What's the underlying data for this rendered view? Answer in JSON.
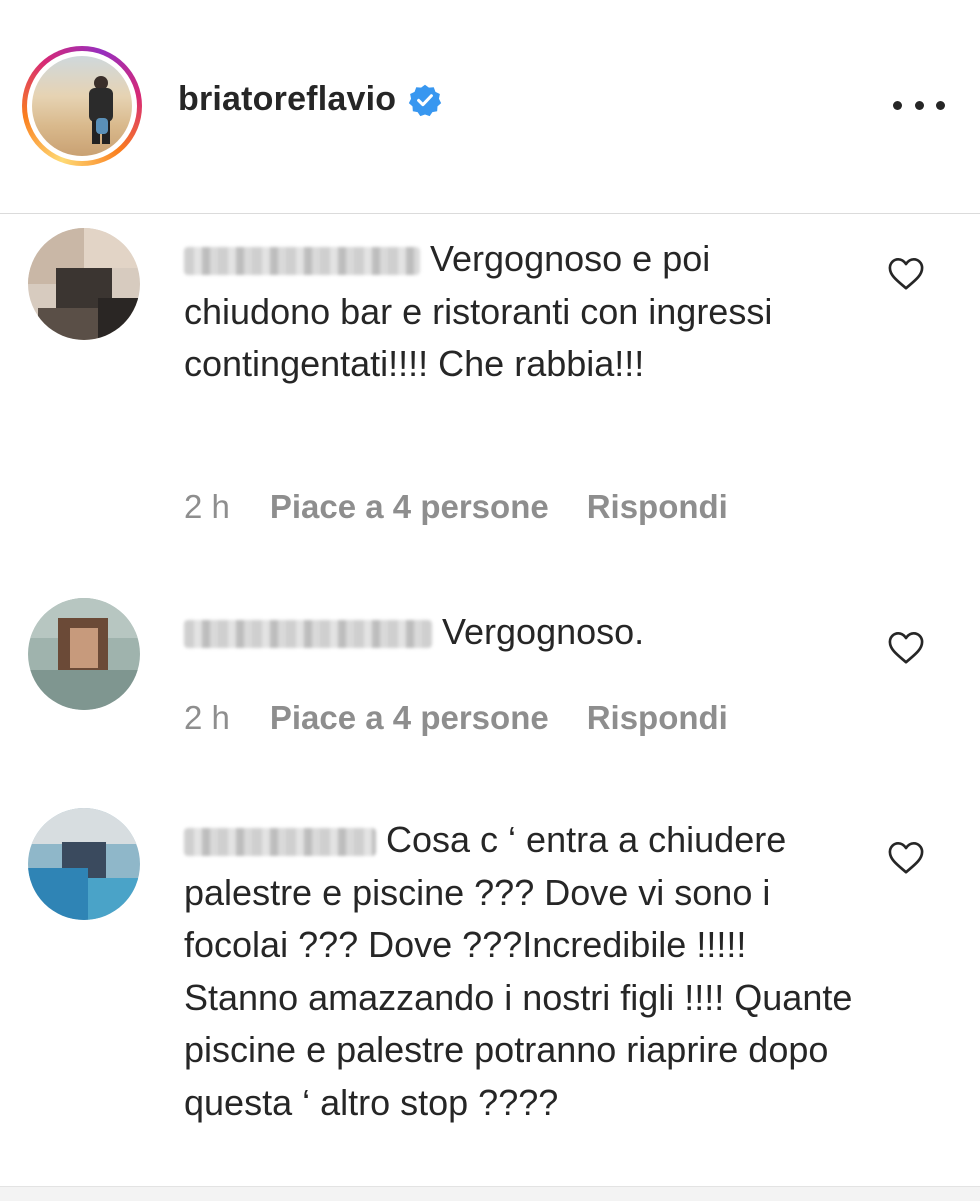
{
  "header": {
    "username": "briatoreflavio",
    "verified_icon": "verified-badge-icon",
    "more_icon": "more-options-icon"
  },
  "colors": {
    "text": "#262626",
    "secondary": "#8e8e8e",
    "verified": "#3897f0"
  },
  "comments": [
    {
      "text": "Vergognoso e poi chiudono bar e ristoranti con ingressi contingentati!!!! Che rabbia!!!",
      "time": "2 h",
      "likes": "Piace a 4 persone",
      "reply": "Rispondi"
    },
    {
      "text": "Vergognoso.",
      "time": "2 h",
      "likes": "Piace a 4 persone",
      "reply": "Rispondi"
    },
    {
      "text": "Cosa c ‘ entra a chiudere palestre e piscine ??? Dove vi sono i focolai ??? Dove ???Incredibile !!!!! Stanno amazzando i nostri figli !!!! Quante piscine e palestre potranno riaprire dopo questa ‘ altro stop ????"
    }
  ]
}
